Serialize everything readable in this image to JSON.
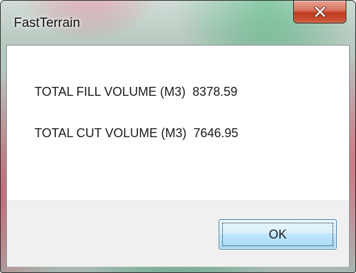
{
  "window": {
    "title": "FastTerrain"
  },
  "titlebar": {
    "close_icon": "close-icon"
  },
  "message": {
    "fill_label": "TOTAL FILL VOLUME (M3)",
    "fill_value": "8378.59",
    "cut_label": "TOTAL CUT VOLUME (M3)",
    "cut_value": "7646.95"
  },
  "buttons": {
    "ok_label": "OK"
  },
  "colors": {
    "close_button": "#c0391f",
    "ok_button_border": "#3c7fb1",
    "button_area_bg": "#f0f0f0"
  }
}
